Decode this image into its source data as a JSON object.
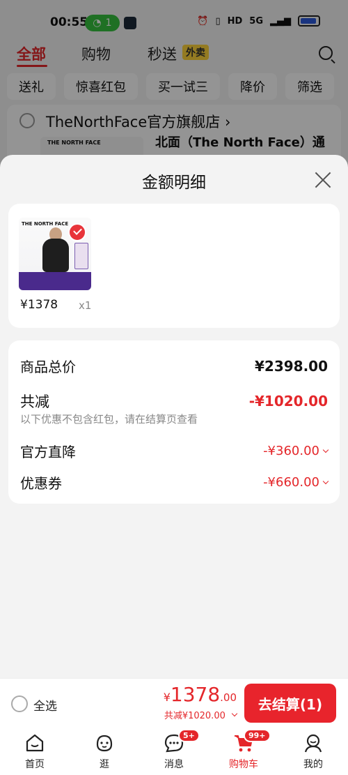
{
  "status_bar": {
    "time": "00:55",
    "hotspot_count": "1",
    "network_label": "5G",
    "hd_label": "HD"
  },
  "background": {
    "tabs": [
      "全部",
      "购物",
      "秒送"
    ],
    "tab_badge": "外卖",
    "chips": [
      "送礼",
      "惊喜红包",
      "买一试三",
      "降价",
      "筛选"
    ],
    "store_name": "TheNorthFace官方旗舰店 ›",
    "store_logo": "THE NORTH FACE",
    "product_title": "北面（The North Face）通"
  },
  "sheet": {
    "title": "金额明细",
    "item": {
      "logo": "THE NORTH FACE",
      "price": "¥1378",
      "qty": "x1"
    },
    "summary": {
      "total_label": "商品总价",
      "total_value": "¥2398.00",
      "reduce_label": "共减",
      "reduce_value": "-¥1020.00",
      "note": "以下优惠不包含红包，请在结算页查看",
      "official_label": "官方直降",
      "official_value": "-¥360.00",
      "coupon_label": "优惠券",
      "coupon_value": "-¥660.00"
    }
  },
  "checkout": {
    "select_all": "全选",
    "currency": "¥",
    "total_int": "1378",
    "total_dec": ".00",
    "discount": "共减¥1020.00",
    "pay_button": "去结算(1)"
  },
  "nav": {
    "items": [
      {
        "label": "首页",
        "icon": "home-icon"
      },
      {
        "label": "逛",
        "icon": "browse-icon"
      },
      {
        "label": "消息",
        "icon": "message-icon",
        "badge": "5+"
      },
      {
        "label": "购物车",
        "icon": "cart-icon",
        "badge": "99+"
      },
      {
        "label": "我的",
        "icon": "profile-icon"
      }
    ]
  },
  "colors": {
    "accent": "#e4262a",
    "pill_green": "#36c13f",
    "sheet_bg": "#f3f3f3"
  }
}
